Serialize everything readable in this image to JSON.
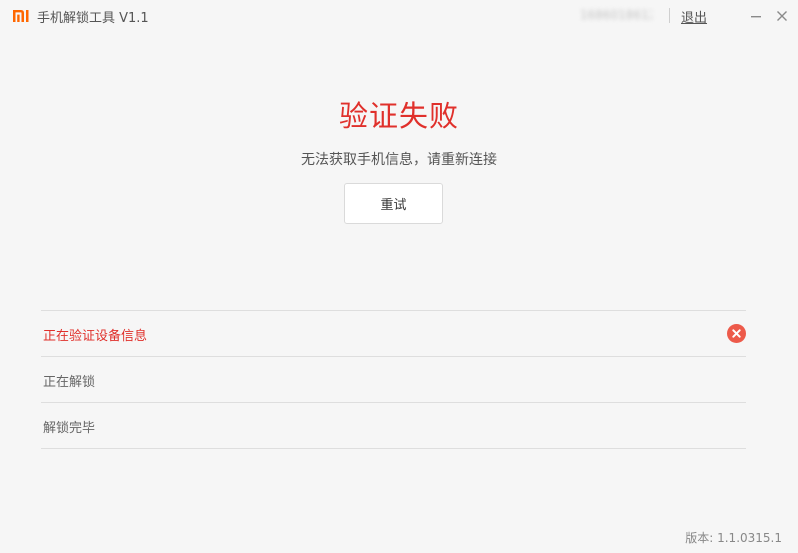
{
  "app": {
    "logo_text": "MI",
    "title": "手机解锁工具  V1.1"
  },
  "titlebar": {
    "account_id": "1686018612",
    "logout_label": "退出",
    "minimize_icon": "minimize-icon",
    "close_icon": "close-icon"
  },
  "status": {
    "title": "验证失败",
    "message": "无法获取手机信息，请重新连接",
    "retry_label": "重试"
  },
  "steps": [
    {
      "label": "正在验证设备信息",
      "state": "error",
      "icon": "error-circle-icon"
    },
    {
      "label": "正在解锁",
      "state": "pending"
    },
    {
      "label": "解锁完毕",
      "state": "pending"
    }
  ],
  "footer": {
    "version": "版本: 1.1.0315.1"
  },
  "colors": {
    "brand": "#ff6700",
    "error": "#e0302b",
    "error_icon": "#ed5a4a"
  }
}
